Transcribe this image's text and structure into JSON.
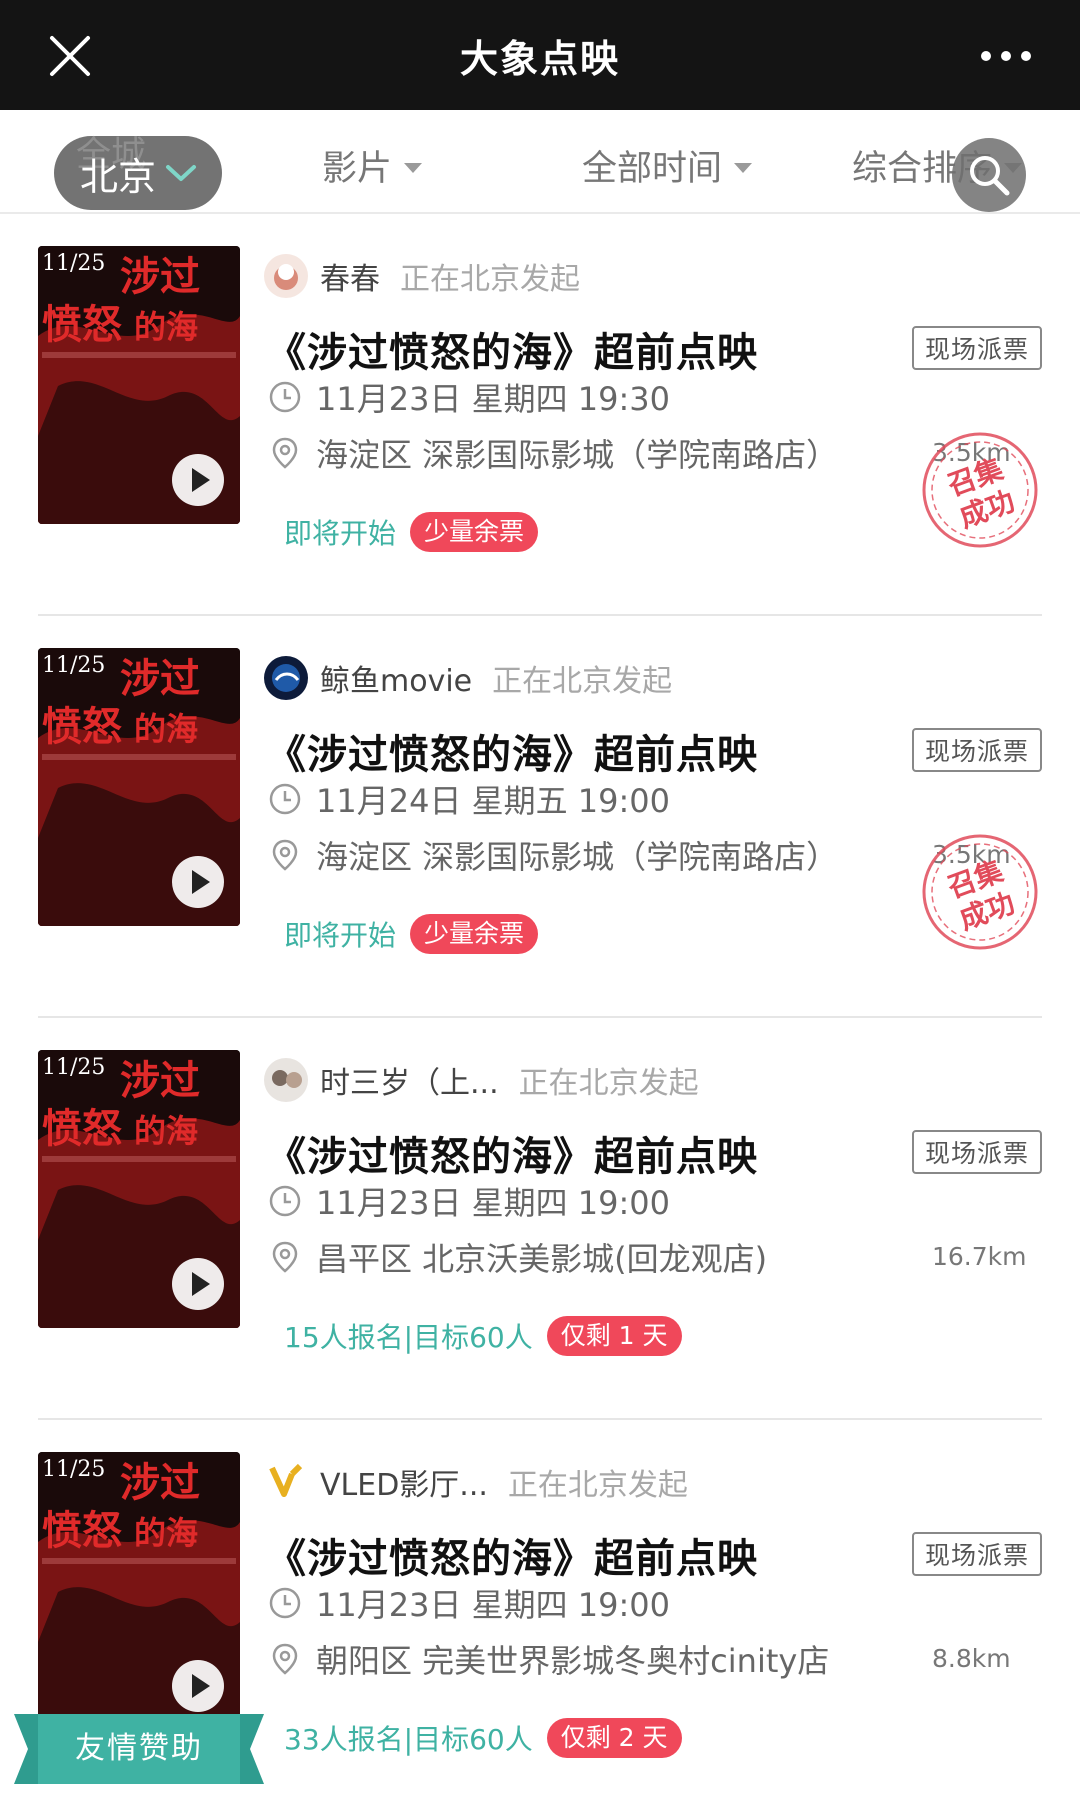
{
  "app": {
    "title": "大象点映",
    "close_icon": "close-icon",
    "more_icon": "more-dots-icon"
  },
  "filters": {
    "city_ghost": "全城",
    "city": "北京",
    "film": "影片",
    "time": "全部时间",
    "sort": "综合排序"
  },
  "colors": {
    "topbar": "#141414",
    "accent_teal": "#3fb2a3",
    "badge_red": "#f0485a",
    "stamp_red": "#e14b5a"
  },
  "events": [
    {
      "organizer": "春春",
      "action": "正在北京发起",
      "title": "《涉过愤怒的海》超前点映",
      "tag": "现场派票",
      "time": "11月23日  星期四  19:30",
      "location": "海淀区  深影国际影城（学院南路店）",
      "distance": "3.5km",
      "status": "即将开始",
      "badge": "少量余票",
      "stamp": [
        "召集",
        "成功"
      ]
    },
    {
      "organizer": "鲸鱼movie",
      "action": "正在北京发起",
      "title": "《涉过愤怒的海》超前点映",
      "tag": "现场派票",
      "time": "11月24日  星期五  19:00",
      "location": "海淀区  深影国际影城（学院南路店）",
      "distance": "3.5km",
      "status": "即将开始",
      "badge": "少量余票",
      "stamp": [
        "召集",
        "成功"
      ]
    },
    {
      "organizer": "时三岁（上...",
      "action": "正在北京发起",
      "title": "《涉过愤怒的海》超前点映",
      "tag": "现场派票",
      "time": "11月23日  星期四  19:00",
      "location": "昌平区  北京沃美影城(回龙观店)",
      "distance": "16.7km",
      "status": "15人报名|目标60人",
      "badge": "仅剩 1 天"
    },
    {
      "organizer": "VLED影厅...",
      "action": "正在北京发起",
      "title": "《涉过愤怒的海》超前点映",
      "tag": "现场派票",
      "time": "11月23日  星期四  19:00",
      "location": "朝阳区  完美世界影城冬奥村cinity店",
      "distance": "8.8km",
      "status": "33人报名|目标60人",
      "badge": "仅剩 2 天"
    }
  ],
  "sponsor_label": "友情赞助",
  "poster_text": {
    "date": "11/25",
    "line1": "涉过",
    "line2": "愤怒",
    "line3": "的海"
  }
}
